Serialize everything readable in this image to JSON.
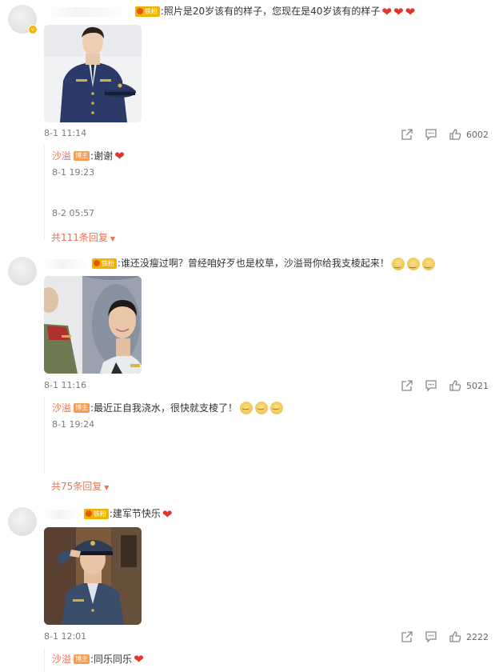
{
  "comments": [
    {
      "text": ":照片是20岁该有的样子，您现在是40岁该有的样子",
      "fan_badge": "铁粉",
      "time": "8-1 11:14",
      "likes": "6002",
      "replies": [
        {
          "name": "沙溢",
          "badge": "博主",
          "text": ":谢谢",
          "time": "8-1 19:23"
        },
        {
          "time": "8-2 05:57"
        }
      ],
      "more": "共111条回复"
    },
    {
      "text": ":谁还没瘦过啊？曾经咱好歹也是校草，沙溢哥你给我支棱起来！",
      "fan_badge": "铁粉",
      "time": "8-1 11:16",
      "likes": "5021",
      "replies": [
        {
          "name": "沙溢",
          "badge": "博主",
          "text": ":最近正自我浇水，很快就支棱了！",
          "time": "8-1 19:24"
        }
      ],
      "more": "共75条回复"
    },
    {
      "text": ":建军节快乐",
      "fan_badge": "铁粉",
      "time": "8-1 12:01",
      "likes": "2222",
      "replies": [
        {
          "name": "沙溢",
          "badge": "博主",
          "text": ":同乐同乐"
        }
      ]
    }
  ],
  "colors": {
    "accent": "#eb7350",
    "heart": "#e2342a",
    "badge": "#f2b300",
    "host_badge": "#f59d52"
  },
  "icons": [
    "share-icon",
    "comment-icon",
    "like-icon",
    "heart-icon",
    "smile-face-icon",
    "fan-badge-icon"
  ]
}
